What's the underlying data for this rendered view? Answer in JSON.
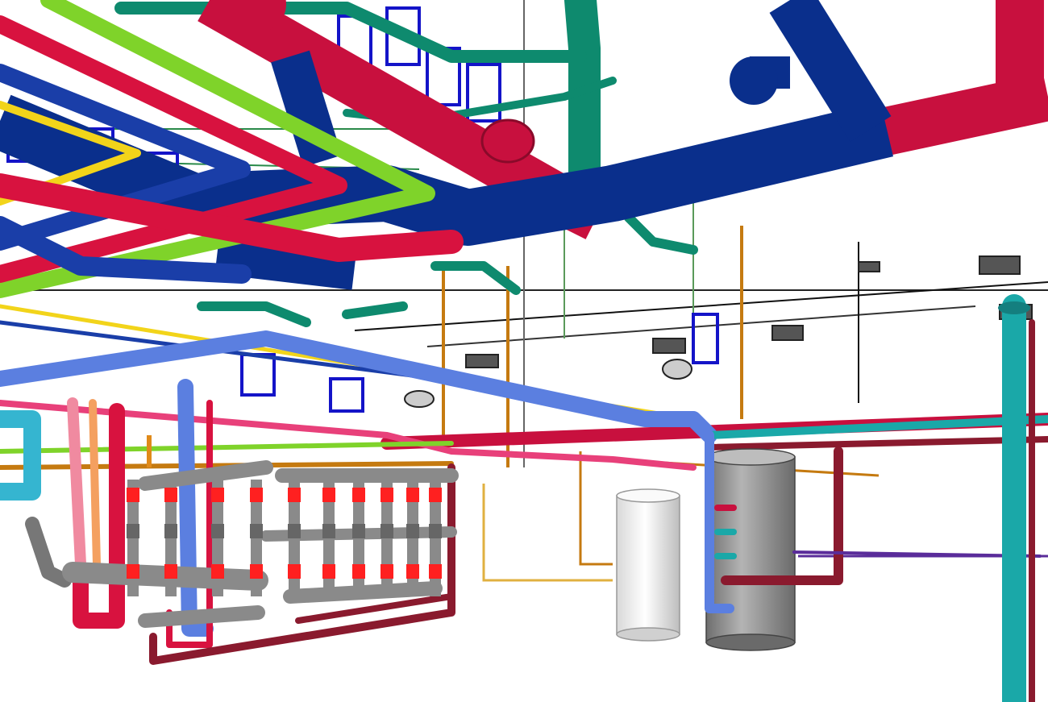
{
  "scene": {
    "kind": "3D MEP pipework and ductwork model render",
    "background": "#ffffff",
    "colors": {
      "duct_blue": "#0a2f8c",
      "duct_magenta": "#c8103e",
      "duct_teal": "#0e8a6e",
      "pipe_green": "#7fd32a",
      "pipe_red": "#d8123f",
      "pipe_navy": "#1a3ea8",
      "pipe_lightblue": "#5b7fe0",
      "pipe_yellow": "#f2d41a",
      "pipe_orange": "#e08a1a",
      "pipe_pink": "#f08aa0",
      "pipe_maroon": "#8a1a2e",
      "pipe_cyan": "#1aa8a8",
      "valve_red": "#ff2020",
      "manifold_gray": "#8a8a8a",
      "tank_white": "#f2f2f2",
      "tank_gray": "#9a9a9a",
      "fixture_blue": "#1414c8"
    },
    "components": {
      "ducts": [
        "main-supply-duct",
        "return-duct",
        "exhaust-duct",
        "riser-duct"
      ],
      "pipes": [
        "green-pipe",
        "red-pipe",
        "navy-pipe",
        "yellow-pipe",
        "lightblue-loop",
        "pink-pipe",
        "maroon-pipe",
        "cyan-pipe",
        "orange-pipe"
      ],
      "equipment": [
        "boiler-tank",
        "storage-tank",
        "manifold-assembly",
        "ceiling-units"
      ],
      "valve_count": 10
    }
  }
}
